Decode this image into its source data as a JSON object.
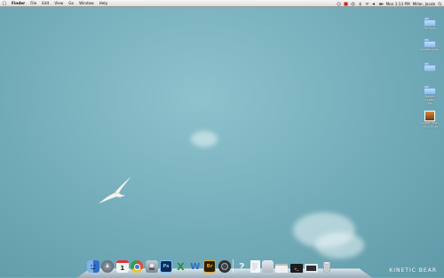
{
  "menubar": {
    "app_name": "Finder",
    "menus": [
      "File",
      "Edit",
      "View",
      "Go",
      "Window",
      "Help"
    ],
    "clock": "Mon 1:13 PM",
    "user": "Miller, Jacob"
  },
  "desktop": {
    "items": [
      {
        "label": "Portfolio",
        "type": "folder"
      },
      {
        "label": "Screenshots",
        "type": "folder"
      },
      {
        "label": "IT",
        "type": "folder"
      },
      {
        "label": "Sample Folder\nSet",
        "type": "folder"
      },
      {
        "label": "Screen Shot\n2011-12-xx",
        "type": "image"
      }
    ]
  },
  "dock": {
    "apps": [
      {
        "name": "finder-icon",
        "label": "",
        "color": "#3b7bd8"
      },
      {
        "name": "launchpad-icon",
        "label": "",
        "color": "#5d6a78"
      },
      {
        "name": "calendar-icon",
        "label": "1",
        "color": "#f4f4f4"
      },
      {
        "name": "chrome-icon",
        "label": "",
        "color": "#e6c13b"
      },
      {
        "name": "preview-icon",
        "label": "",
        "color": "#8f9aa3"
      },
      {
        "name": "photoshop-icon",
        "label": "Ps",
        "color": "#0d2a56"
      },
      {
        "name": "excel-icon",
        "label": "X",
        "color": "#2c8a3e"
      },
      {
        "name": "word-icon",
        "label": "W",
        "color": "#2f6bc4"
      },
      {
        "name": "bridge-icon",
        "label": "Br",
        "color": "#2c1f08"
      },
      {
        "name": "clock-icon",
        "label": "",
        "color": "#303336"
      }
    ],
    "others": [
      {
        "name": "help-icon",
        "label": "?",
        "color": "#e9eef3"
      },
      {
        "name": "document-icon",
        "label": "",
        "color": "#f4f7fa"
      },
      {
        "name": "stack-icon",
        "label": "",
        "color": "#c9d2dc"
      },
      {
        "name": "window-icon",
        "label": "",
        "color": "#f0f0f0"
      },
      {
        "name": "terminal-icon",
        "label": "",
        "color": "#1c1c1c"
      },
      {
        "name": "screen-icon",
        "label": "",
        "color": "#e4e8ec"
      },
      {
        "name": "trash-icon",
        "label": "",
        "color": "#d6dadf"
      }
    ]
  },
  "watermark": "KINETIC BEAR"
}
